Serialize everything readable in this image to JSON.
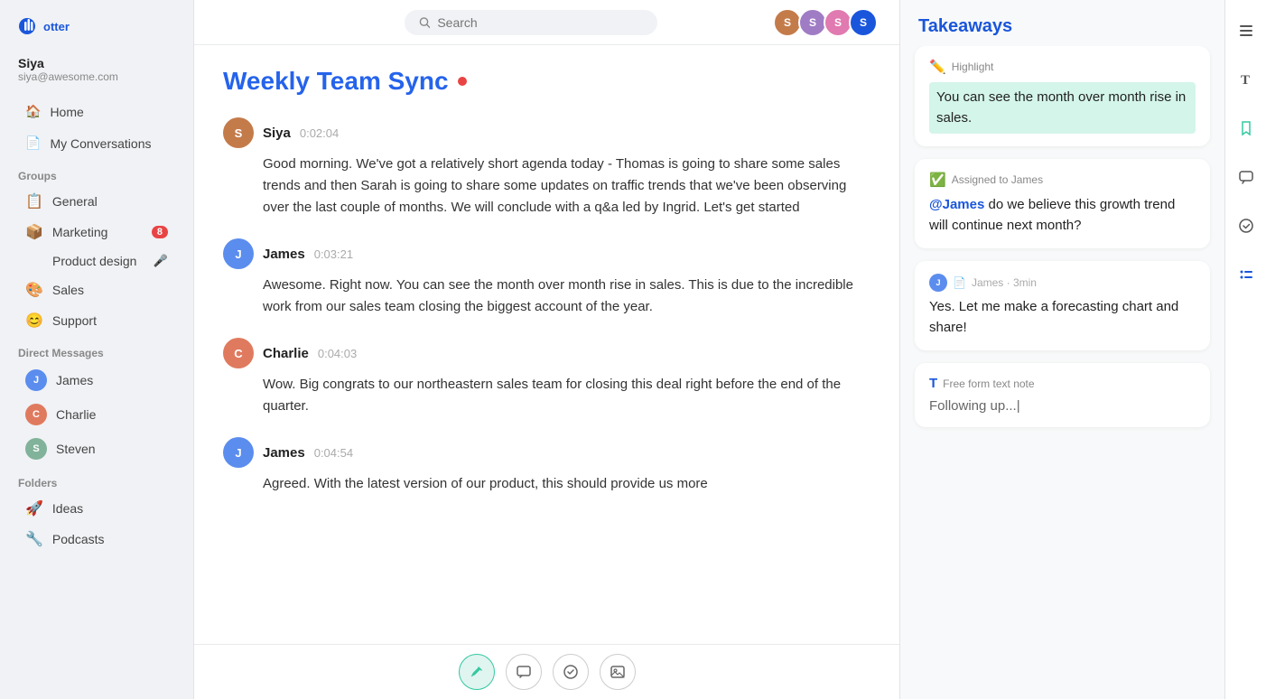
{
  "app": {
    "title": "Otter.ai"
  },
  "user": {
    "name": "Siya",
    "email": "siya@awesome.com"
  },
  "search": {
    "placeholder": "Search"
  },
  "topbar_avatars": [
    {
      "initials": "S1",
      "color": "#c47b4a"
    },
    {
      "initials": "S2",
      "color": "#a07cc5"
    },
    {
      "initials": "S3",
      "color": "#e07ab0"
    },
    {
      "initials": "S4",
      "color": "#1a56db"
    }
  ],
  "nav": {
    "home_label": "Home",
    "my_conversations_label": "My Conversations"
  },
  "groups": {
    "section_label": "Groups",
    "items": [
      {
        "label": "General",
        "emoji": "📋",
        "badge": null
      },
      {
        "label": "Marketing",
        "emoji": "📦",
        "badge": "8"
      },
      {
        "label": "Product design",
        "emoji": "",
        "mic": true
      },
      {
        "label": "Sales",
        "emoji": "🎨",
        "badge": null
      },
      {
        "label": "Support",
        "emoji": "😊",
        "badge": null
      }
    ]
  },
  "direct_messages": {
    "section_label": "Direct Messages",
    "items": [
      {
        "name": "James",
        "initials": "J",
        "color": "#5b8dee"
      },
      {
        "name": "Charlie",
        "initials": "C",
        "color": "#e07a5f"
      },
      {
        "name": "Steven",
        "initials": "S",
        "color": "#81b29a"
      }
    ]
  },
  "folders": {
    "section_label": "Folders",
    "items": [
      {
        "label": "Ideas",
        "emoji": "🚀"
      },
      {
        "label": "Podcasts",
        "emoji": "🔧"
      }
    ]
  },
  "meeting": {
    "title": "Weekly Team Sync"
  },
  "messages": [
    {
      "sender": "Siya",
      "initials": "S",
      "color": "#c47b4a",
      "time": "0:02:04",
      "text": "Good morning. We've got a relatively short agenda today - Thomas is going to share some sales trends and then Sarah is going to share some updates on traffic trends that we've been observing over the last couple of months. We will conclude with a q&a led by Ingrid. Let's get started"
    },
    {
      "sender": "James",
      "initials": "J",
      "color": "#5b8dee",
      "time": "0:03:21",
      "text": "Awesome. Right now. You can see the month over month rise in sales. This is due to the incredible work from our sales team closing the biggest account of the year."
    },
    {
      "sender": "Charlie",
      "initials": "C",
      "color": "#e07a5f",
      "time": "0:04:03",
      "text": "Wow. Big congrats to our northeastern sales team for closing this deal right before the end of the quarter."
    },
    {
      "sender": "James",
      "initials": "J",
      "color": "#5b8dee",
      "time": "0:04:54",
      "text": "Agreed. With the latest version of our product, this should provide us more"
    }
  ],
  "takeaways": {
    "title": "Takeaways",
    "cards": [
      {
        "type": "highlight",
        "label": "Highlight",
        "label_color": "#34c9a0",
        "text": "You can see the month over month rise in sales.",
        "highlight_bg": "#d4f5e9"
      },
      {
        "type": "assign",
        "label": "Assigned to James",
        "label_color": "#1a56db",
        "text": "@James do we believe this growth trend will continue next month?",
        "mention": "@James"
      },
      {
        "type": "note",
        "label": "James · 3min",
        "author_initials": "J",
        "author_color": "#5b8dee",
        "text": "Yes. Let me make a forecasting chart and share!"
      },
      {
        "type": "freeform",
        "label": "Free form text note",
        "placeholder": "Following up...",
        "current_value": "Following up...|"
      }
    ]
  },
  "toolbar": {
    "highlight_icon": "✏️",
    "comment_icon": "💬",
    "check_icon": "✓",
    "image_icon": "🖼"
  },
  "rail_icons": [
    {
      "name": "list-icon",
      "symbol": "≡"
    },
    {
      "name": "text-icon",
      "symbol": "T"
    },
    {
      "name": "bookmark-icon",
      "symbol": "🔖"
    },
    {
      "name": "chat-icon",
      "symbol": "💬"
    },
    {
      "name": "check-circle-icon",
      "symbol": "✓"
    },
    {
      "name": "bullet-list-icon",
      "symbol": "⋮≡"
    }
  ]
}
